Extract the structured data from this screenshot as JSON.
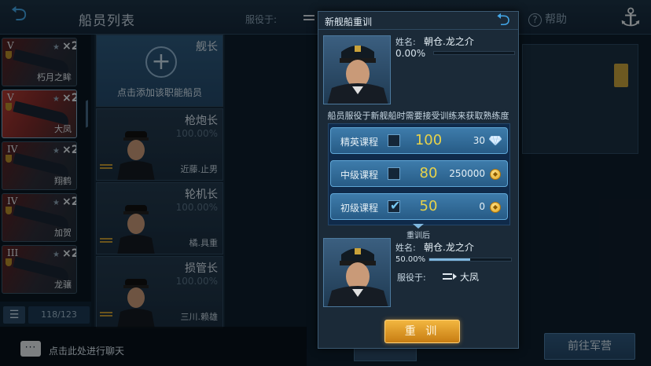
{
  "header": {
    "title": "船员列表",
    "serving_label": "服役于:",
    "help_label": "帮助"
  },
  "ships": [
    {
      "tier": "V",
      "mult": "×2",
      "name": "朽月之眸"
    },
    {
      "tier": "V",
      "mult": "×2",
      "name": "大凤"
    },
    {
      "tier": "IV",
      "mult": "×2",
      "name": "翔鹤"
    },
    {
      "tier": "IV",
      "mult": "×2",
      "name": "加贺"
    },
    {
      "tier": "III",
      "mult": "×2",
      "name": "龙骧"
    }
  ],
  "ship_count": "118/123",
  "crew": {
    "captain_role": "舰长",
    "add_text": "点击添加该职能船员",
    "slots": [
      {
        "role": "枪炮长",
        "pct": "100.00%",
        "name": "近藤.止男"
      },
      {
        "role": "轮机长",
        "pct": "100.00%",
        "name": "橘.具重"
      },
      {
        "role": "损管长",
        "pct": "100.00%",
        "name": "三川.赖雄"
      }
    ]
  },
  "chat": {
    "text": "点击此处进行聊天"
  },
  "go_military_label": "前往军营",
  "dialog": {
    "title": "新舰船重训",
    "name_label": "姓名:",
    "before": {
      "name": "朝仓.龙之介",
      "pct_text": "0.00%",
      "progress": 0.0
    },
    "hint": "船员服役于新舰船时需要接受训练来获取熟练度",
    "courses": [
      {
        "name": "精英课程",
        "checked": false,
        "points": "100",
        "cost": "30",
        "currency": "diamond-icon"
      },
      {
        "name": "中级课程",
        "checked": false,
        "points": "80",
        "cost": "250000",
        "currency": "coin-icon"
      },
      {
        "name": "初级课程",
        "checked": true,
        "points": "50",
        "cost": "0",
        "currency": "coin-icon"
      }
    ],
    "after_label": "重训后",
    "after": {
      "name": "朝仓.龙之介",
      "pct_text": "50.00%",
      "progress": 0.5,
      "serve_label": "服役于:",
      "ship": "大凤"
    },
    "retrain_label": "重 训"
  },
  "colors": {
    "accent": "#43a7e8",
    "gold": "#e8d34a",
    "button_gold": "#f2b640"
  }
}
